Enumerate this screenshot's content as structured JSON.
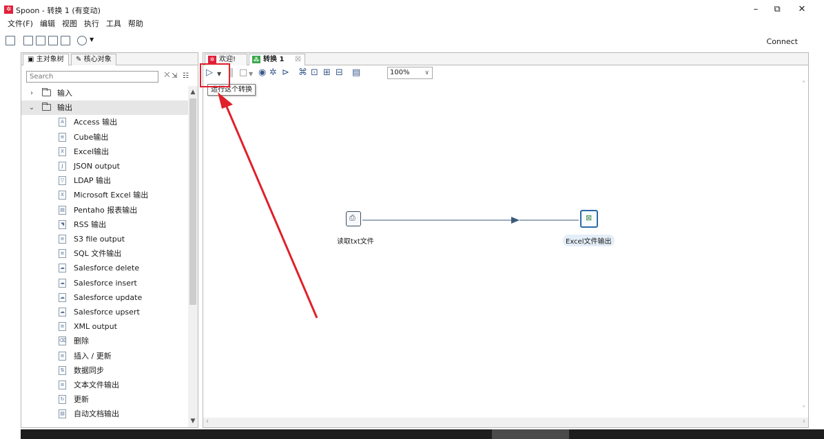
{
  "window": {
    "title": "Spoon - 转换 1 (有变动)",
    "logo_glyph": "✲",
    "controls": [
      "–",
      "⧉",
      "✕"
    ]
  },
  "menubar": [
    "文件(F)",
    "编辑",
    "视图",
    "执行",
    "工具",
    "帮助"
  ],
  "main_toolbar": {
    "connect_label": "Connect"
  },
  "left_panel": {
    "tabs": [
      "主对象树",
      "核心对象"
    ],
    "search_placeholder": "Search",
    "tree": [
      {
        "label": "输入",
        "type": "folder",
        "expanded": false
      },
      {
        "label": "输出",
        "type": "folder",
        "expanded": true
      },
      {
        "label": "Access 输出",
        "type": "leaf",
        "glyph": "A"
      },
      {
        "label": "Cube输出",
        "type": "leaf",
        "glyph": "≡"
      },
      {
        "label": "Excel输出",
        "type": "leaf",
        "glyph": "X"
      },
      {
        "label": "JSON output",
        "type": "leaf",
        "glyph": "J"
      },
      {
        "label": "LDAP 输出",
        "type": "leaf",
        "glyph": "▽"
      },
      {
        "label": "Microsoft Excel 输出",
        "type": "leaf",
        "glyph": "X"
      },
      {
        "label": "Pentaho 报表输出",
        "type": "leaf",
        "glyph": "▤"
      },
      {
        "label": "RSS 输出",
        "type": "leaf",
        "glyph": "◥"
      },
      {
        "label": "S3 file output",
        "type": "leaf",
        "glyph": "≡"
      },
      {
        "label": "SQL 文件输出",
        "type": "leaf",
        "glyph": "≡"
      },
      {
        "label": "Salesforce delete",
        "type": "leaf",
        "glyph": "☁"
      },
      {
        "label": "Salesforce insert",
        "type": "leaf",
        "glyph": "☁"
      },
      {
        "label": "Salesforce update",
        "type": "leaf",
        "glyph": "☁"
      },
      {
        "label": "Salesforce upsert",
        "type": "leaf",
        "glyph": "☁"
      },
      {
        "label": "XML output",
        "type": "leaf",
        "glyph": "≡"
      },
      {
        "label": "删除",
        "type": "leaf",
        "glyph": "⌫"
      },
      {
        "label": "插入 / 更新",
        "type": "leaf",
        "glyph": "≡"
      },
      {
        "label": "数据同步",
        "type": "leaf",
        "glyph": "⇅"
      },
      {
        "label": "文本文件输出",
        "type": "leaf",
        "glyph": "≡"
      },
      {
        "label": "更新",
        "type": "leaf",
        "glyph": "↻"
      },
      {
        "label": "自动文档输出",
        "type": "leaf",
        "glyph": "▤"
      }
    ]
  },
  "right_panel": {
    "tabs": [
      {
        "label": "欢迎!",
        "badge_color": "#e0203a",
        "active": false
      },
      {
        "label": "转换 1",
        "badge_color": "#3aa84a",
        "active": true,
        "close": "☒"
      }
    ],
    "zoom": "100%",
    "tooltip": "运行这个转换",
    "steps": [
      {
        "name": "读取txt文件",
        "selected": false
      },
      {
        "name": "Excel文件输出",
        "selected": true
      }
    ]
  },
  "colors": {
    "accent_red": "#e0202a",
    "hop_line": "#3a5a7a",
    "selected_step": "#2a6aa8"
  }
}
